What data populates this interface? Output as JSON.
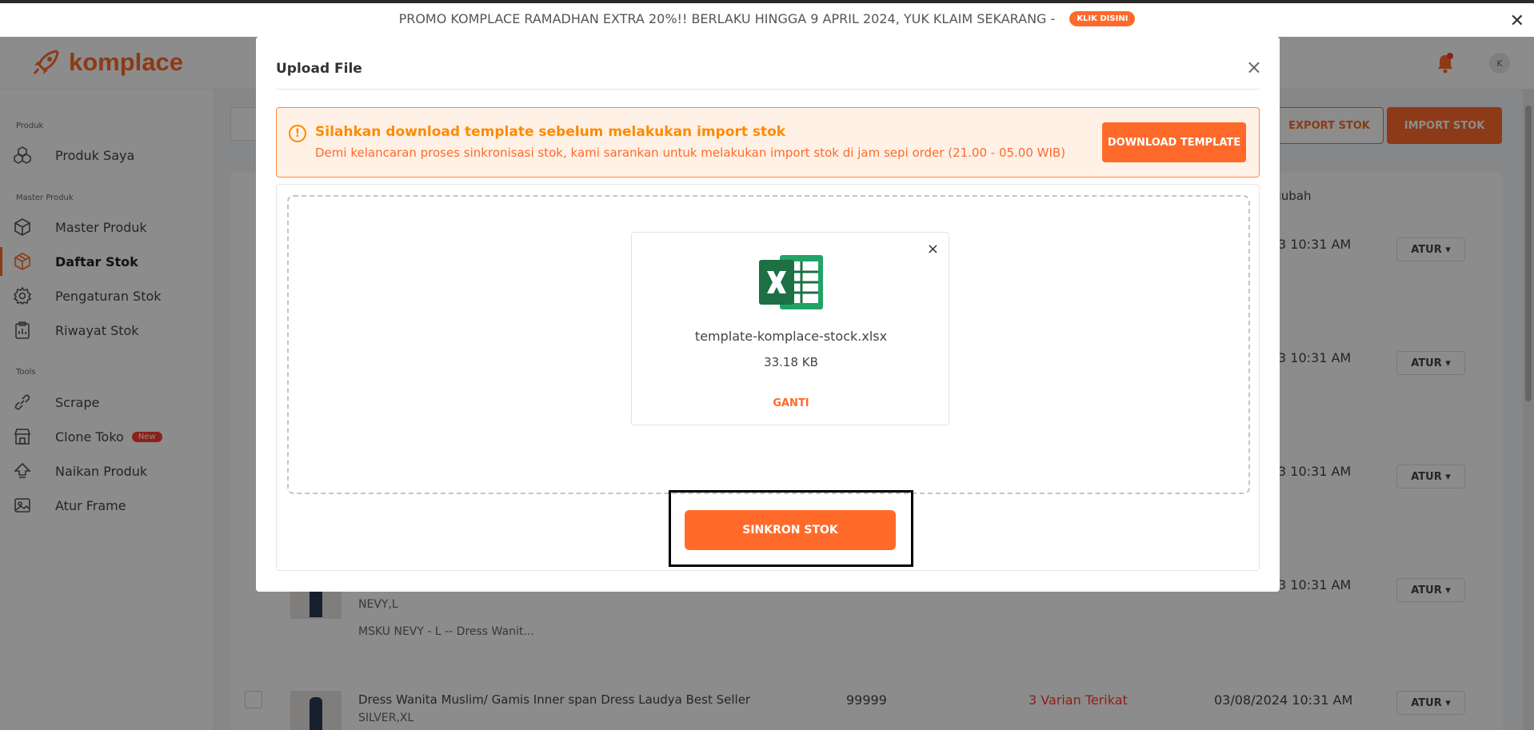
{
  "promo": {
    "text": "PROMO KOMPLACE RAMADHAN EXTRA 20%!! BERLAKU HINGGA 9 APRIL 2024, YUK KLAIM SEKARANG  -",
    "badge": "KLIK DISINI",
    "close": "✕"
  },
  "header": {
    "brand": "komplace",
    "avatar_initial": "K"
  },
  "sidebar": {
    "sections": {
      "produk": "Produk",
      "master_produk": "Master Produk",
      "tools": "Tools"
    },
    "items": [
      {
        "label": "Produk Saya",
        "icon": "cubes-icon"
      },
      {
        "label": "Master Produk",
        "icon": "box-icon"
      },
      {
        "label": "Daftar Stok",
        "icon": "box-active-icon"
      },
      {
        "label": "Pengaturan Stok",
        "icon": "gear-icon"
      },
      {
        "label": "Riwayat Stok",
        "icon": "clipboard-icon"
      },
      {
        "label": "Scrape",
        "icon": "link-icon"
      },
      {
        "label": "Clone Toko",
        "icon": "store-icon",
        "badge": "New"
      },
      {
        "label": "Naikan Produk",
        "icon": "boost-icon"
      },
      {
        "label": "Atur Frame",
        "icon": "frame-icon"
      }
    ]
  },
  "main": {
    "export_label": "EXPORT STOK",
    "import_label": "IMPORT STOK",
    "col_diubah": "Diubah",
    "atur_label": "ATUR",
    "rows": [
      {
        "time": "3 10:31 AM"
      },
      {
        "time": "3 10:31 AM"
      },
      {
        "time": "3 10:31 AM"
      },
      {
        "time": "3 10:31 AM",
        "variant": "NEVY,L",
        "sku": "MSKU  NEVY - L -- Dress Wanit..."
      },
      {
        "time": "03/08/2024 10:31 AM",
        "name": "Dress Wanita Muslim/ Gamis Inner span Dress Laudya Best Seller",
        "variant": "SILVER,XL",
        "stock": "99999",
        "varian_terikat": "3 Varian Terikat"
      }
    ]
  },
  "modal": {
    "title": "Upload File",
    "close": "×",
    "notice_title": "Silahkan download template sebelum melakukan import stok",
    "notice_desc": "Demi kelancaran proses sinkronisasi stok, kami sarankan untuk melakukan import stok di jam sepi order (21.00 - 05.00 WIB)",
    "download_label": "DOWNLOAD TEMPLATE",
    "file": {
      "name": "template-komplace-stock.xlsx",
      "size": "33.18 KB",
      "remove": "×",
      "replace_label": "GANTI",
      "icon": "excel-icon"
    },
    "sync_label": "SINKRON STOK"
  },
  "colors": {
    "accent": "#ff6a2b",
    "warning": "#ff8a00",
    "excel_green": "#1d7044"
  }
}
